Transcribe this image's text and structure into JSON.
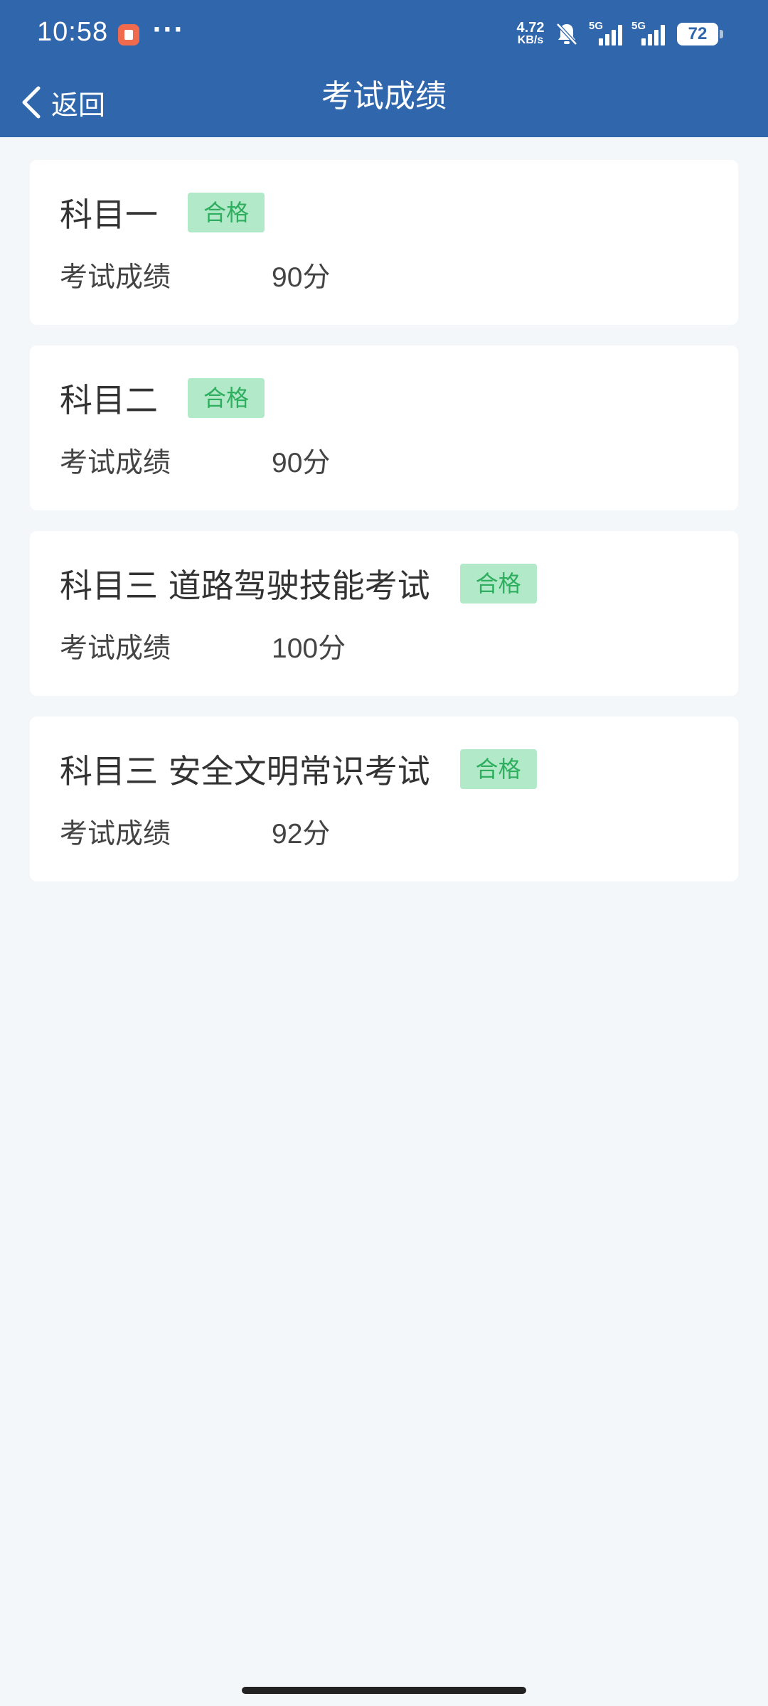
{
  "status_bar": {
    "time": "10:58",
    "more": "···",
    "net_speed_value": "4.72",
    "net_speed_unit": "KB/s",
    "signal1_label": "5G",
    "signal2_label": "5G",
    "battery": "72"
  },
  "nav": {
    "back_label": "返回",
    "title": "考试成绩"
  },
  "colors": {
    "header_bg": "#2f66ac",
    "page_bg": "#f4f7f9",
    "badge_bg": "#b2e9c8",
    "badge_text": "#2fae5f"
  },
  "results": [
    {
      "subject": "科目一",
      "status": "合格",
      "score_label": "考试成绩",
      "score": "90分"
    },
    {
      "subject": "科目二",
      "status": "合格",
      "score_label": "考试成绩",
      "score": "90分"
    },
    {
      "subject": "科目三 道路驾驶技能考试",
      "status": "合格",
      "score_label": "考试成绩",
      "score": "100分"
    },
    {
      "subject": "科目三 安全文明常识考试",
      "status": "合格",
      "score_label": "考试成绩",
      "score": "92分"
    }
  ]
}
